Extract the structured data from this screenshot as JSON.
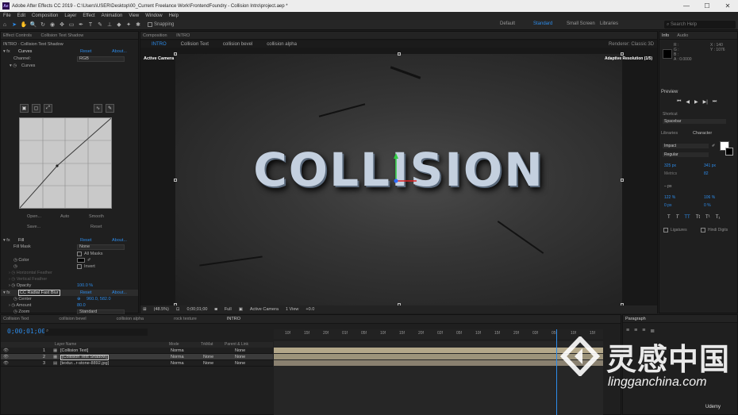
{
  "window": {
    "title": "Adobe After Effects CC 2019 - C:\\Users\\USER\\Desktop\\00_Current Freelance Work\\FrontendFoundry - Collision Intro\\project.aep *",
    "controls": [
      "—",
      "☐",
      "✕"
    ]
  },
  "menu": [
    "File",
    "Edit",
    "Composition",
    "Layer",
    "Effect",
    "Animation",
    "View",
    "Window",
    "Help"
  ],
  "toolbar": {
    "snapping_label": "Snapping",
    "workspaces": [
      "Default",
      "Standard",
      "Small Screen",
      "Libraries"
    ],
    "active_workspace": "Standard",
    "search_placeholder": "Search Help"
  },
  "effect_controls": {
    "tab": "Effect Controls",
    "layer": "Collision Text Shadow",
    "path": "INTRO · Collision Text Shadow",
    "curves": {
      "name": "Curves",
      "reset": "Reset",
      "about": "About...",
      "channel_label": "Channel:",
      "channel_value": "RGB",
      "curves_label": "Curves",
      "buttons": [
        "Open...",
        "Auto",
        "Smooth",
        "Save...",
        "Reset"
      ]
    },
    "fill": {
      "name": "Fill",
      "reset": "Reset",
      "about": "About...",
      "fill_mask_label": "Fill Mask",
      "fill_mask_value": "None",
      "all_masks": "All Masks",
      "color_label": "Color",
      "invert": "Invert",
      "hf_label": "Horizontal Feather",
      "vf_label": "Vertical Feather",
      "opacity_label": "Opacity",
      "opacity_value": "100.0 %"
    },
    "cc_radial": {
      "name": "CC Radial Fast Blur",
      "reset": "Reset",
      "about": "About...",
      "center_label": "Center",
      "center_value": "960.0, 582.0",
      "amount_label": "Amount",
      "amount_value": "80.0",
      "zoom_label": "Zoom",
      "zoom_value": "Standard"
    }
  },
  "composition": {
    "tab": "Composition",
    "name": "INTRO",
    "breadcrumbs": [
      "INTRO",
      "Collision Text",
      "collision bevel",
      "collision alpha"
    ],
    "renderer_label": "Renderer:",
    "renderer_value": "Classic 3D",
    "view_label": "Active Camera",
    "adaptive": "Adaptive Resolution (1/5)",
    "title_text": "COLLISION",
    "footer": [
      "(48.5%)",
      "0;00;01;00",
      "Full",
      "Active Camera",
      "1 View",
      "+0.0"
    ]
  },
  "right_panel": {
    "info_tab": "Info",
    "audio_tab": "Audio",
    "info_values": [
      "R :",
      "G :",
      "B :",
      "A : 0.0000",
      "X : 140",
      "Y : 1076"
    ],
    "preview_tab": "Preview",
    "shortcut_label": "Shortcut",
    "shortcut_value": "Spacebar",
    "libraries_tab": "Libraries",
    "character_tab": "Character",
    "font": "Impact",
    "style": "Regular",
    "size": "325 px",
    "leading": "341 px",
    "tracking_label": "Metrics",
    "tracking": "82",
    "baseline": "– px",
    "vscale": "122 %",
    "hscale": "106 %",
    "tsume": "0 px",
    "tsume2": "0 %",
    "type_buttons": [
      "T",
      "T",
      "TT",
      "Tt",
      "T¹",
      "T₁"
    ],
    "ligatures": "Ligatures",
    "hindi_digits": "Hindi Digits",
    "colors": {
      "fill": "#ffffff",
      "stroke": "#000000"
    }
  },
  "timeline": {
    "tabs": [
      "Collision Text",
      "collision bevel",
      "collision alpha",
      "rock texture",
      "INTRO"
    ],
    "active_tab": "INTRO",
    "timecode": "0;00;01;00",
    "headers": [
      "Layer Name",
      "Mode",
      "TrkMat",
      "Parent & Link"
    ],
    "layers": [
      {
        "num": "1",
        "name": "[Collision Text]",
        "mode": "Norma",
        "trkmat": "",
        "parent": "None"
      },
      {
        "num": "2",
        "name": "[Collision Text Shadow]",
        "mode": "Norma",
        "trkmat": "None",
        "parent": "None"
      },
      {
        "num": "3",
        "name": "[textur...r-stone-8892.jpg]",
        "mode": "Norma",
        "trkmat": "None",
        "parent": "None"
      }
    ],
    "ruler_ticks": [
      "10f",
      "15f",
      "20f",
      "01f",
      "05f",
      "10f",
      "15f",
      "20f",
      "02f",
      "05f",
      "10f",
      "15f",
      "20f",
      "03f",
      "05f",
      "10f",
      "15f"
    ],
    "bar_colors": [
      "#b3a789",
      "#9c937a",
      "#8a8170"
    ]
  },
  "paragraph_tab": "Paragraph",
  "watermark": {
    "cn": "灵感中国",
    "en": "lingganchina.com",
    "udemy": "Udemy"
  }
}
